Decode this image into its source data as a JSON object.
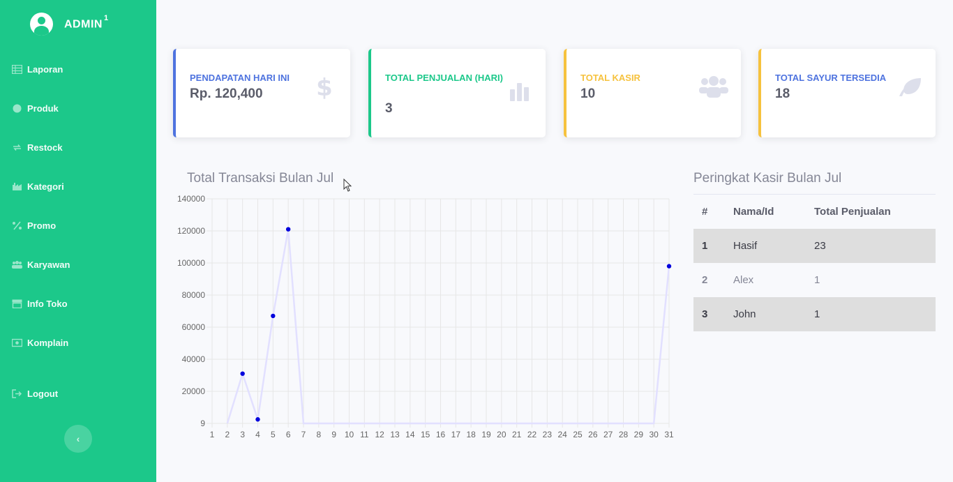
{
  "sidebar": {
    "brand": "ADMIN",
    "brand_sup": "1",
    "items": [
      {
        "label": "Laporan",
        "icon": "table-icon"
      },
      {
        "label": "Produk",
        "icon": "circle-icon"
      },
      {
        "label": "Restock",
        "icon": "sync-icon"
      },
      {
        "label": "Kategori",
        "icon": "industry-icon"
      },
      {
        "label": "Promo",
        "icon": "percent-icon"
      },
      {
        "label": "Karyawan",
        "icon": "users-icon"
      },
      {
        "label": "Info Toko",
        "icon": "store-icon"
      },
      {
        "label": "Komplain",
        "icon": "money-icon"
      }
    ],
    "logout": "Logout",
    "toggle": "‹"
  },
  "cards": [
    {
      "label": "PENDAPATAN HARI INI",
      "value": "Rp. 120,400",
      "color": "#4e73df",
      "icon": "dollar-icon"
    },
    {
      "label": "TOTAL PENJUALAN (HARI)",
      "value": "3",
      "color": "#1cc88a",
      "icon": "bar-chart-icon"
    },
    {
      "label": "TOTAL KASIR",
      "value": "10",
      "color": "#f6c23e",
      "icon": "users-icon"
    },
    {
      "label": "TOTAL SAYUR TERSEDIA",
      "value": "18",
      "color": "#f6c23e",
      "label_color": "#4e73df",
      "icon": "leaf-icon"
    }
  ],
  "chart_title": "Total Transaksi Bulan Jul",
  "chart_data": {
    "type": "line",
    "title": "Total Transaksi Bulan Jul",
    "categories": [
      "1",
      "2",
      "3",
      "4",
      "5",
      "6",
      "7",
      "8",
      "9",
      "10",
      "11",
      "12",
      "13",
      "14",
      "15",
      "16",
      "17",
      "18",
      "19",
      "20",
      "21",
      "22",
      "23",
      "24",
      "25",
      "26",
      "27",
      "28",
      "29",
      "30",
      "31"
    ],
    "y_tick_labels": [
      "9",
      "20000",
      "40000",
      "60000",
      "80000",
      "100000",
      "120000",
      "140000"
    ],
    "ylim": [
      0,
      140000
    ],
    "grid": true,
    "series": [
      {
        "color": "#0000dd",
        "line_color": "#e2e0ff",
        "points": [
          {
            "x": "2",
            "y": 0,
            "marker": false
          },
          {
            "x": "3",
            "y": 31000,
            "marker": true
          },
          {
            "x": "4",
            "y": 2500,
            "marker": true
          },
          {
            "x": "5",
            "y": 67000,
            "marker": true
          },
          {
            "x": "6",
            "y": 121000,
            "marker": true
          },
          {
            "x": "7",
            "y": 0,
            "marker": false
          },
          {
            "x": "30",
            "y": 0,
            "marker": false
          },
          {
            "x": "31",
            "y": 98000,
            "marker": true
          }
        ]
      }
    ]
  },
  "ranking": {
    "title": "Peringkat Kasir Bulan Jul",
    "headers": [
      "#",
      "Nama/Id",
      "Total Penjualan"
    ],
    "rows": [
      [
        "1",
        "Hasif",
        "23"
      ],
      [
        "2",
        "Alex",
        "1"
      ],
      [
        "3",
        "John",
        "1"
      ]
    ]
  }
}
